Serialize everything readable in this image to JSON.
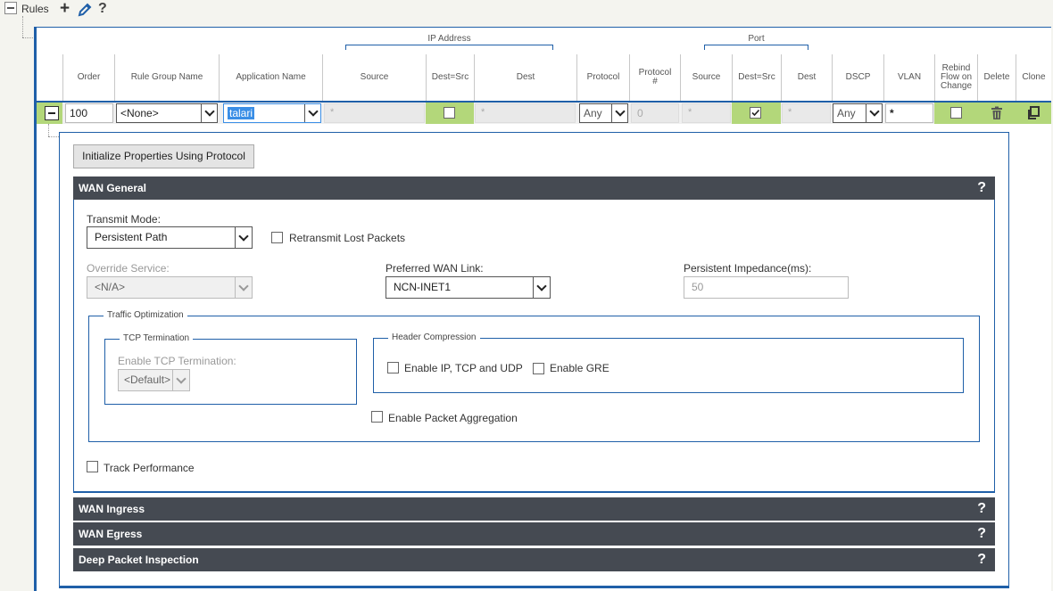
{
  "tree": {
    "title": "Rules"
  },
  "toolbar": {
    "add_symbol": "+",
    "help_symbol": "?"
  },
  "grid": {
    "groups": {
      "ip_address": "IP Address",
      "port": "Port"
    },
    "headers": {
      "order": "Order",
      "rule_group_name": "Rule Group Name",
      "application_name": "Application Name",
      "ip_source": "Source",
      "ip_dest_src": "Dest=Src",
      "ip_dest": "Dest",
      "protocol": "Protocol",
      "protocol_num": "Protocol #",
      "port_source": "Source",
      "port_dest_src": "Dest=Src",
      "port_dest": "Dest",
      "dscp": "DSCP",
      "vlan": "VLAN",
      "rebind": "Rebind Flow on Change",
      "delete": "Delete",
      "clone": "Clone"
    },
    "row": {
      "order": "100",
      "rule_group_name": "<None>",
      "application_name": "talari",
      "ip_source": "*",
      "ip_dest_src_checked": false,
      "ip_dest": "*",
      "protocol": "Any",
      "protocol_num": "0",
      "port_source": "*",
      "port_dest_src_checked": true,
      "port_dest": "*",
      "dscp": "Any",
      "vlan": "*",
      "rebind_checked": false
    }
  },
  "detail": {
    "init_button": "Initialize Properties Using Protocol",
    "sections": {
      "wan_general": "WAN General",
      "wan_ingress": "WAN Ingress",
      "wan_egress": "WAN Egress",
      "dpi": "Deep Packet Inspection"
    },
    "help_symbol": "?",
    "wan_general": {
      "transmit_mode_label": "Transmit Mode:",
      "transmit_mode": "Persistent Path",
      "retransmit_label": "Retransmit Lost Packets",
      "override_service_label": "Override Service:",
      "override_service": "<N/A>",
      "preferred_wan_link_label": "Preferred WAN Link:",
      "preferred_wan_link": "NCN-INET1",
      "persistent_impedance_label": "Persistent Impedance(ms):",
      "persistent_impedance": "50",
      "traffic_optimization_legend": "Traffic Optimization",
      "tcp_termination_legend": "TCP Termination",
      "enable_tcp_termination_label": "Enable TCP Termination:",
      "enable_tcp_termination": "<Default>",
      "header_compression_legend": "Header Compression",
      "enable_ip_tcp_udp_label": "Enable IP, TCP and UDP",
      "enable_gre_label": "Enable GRE",
      "enable_packet_aggregation_label": "Enable Packet Aggregation",
      "track_performance_label": "Track Performance"
    }
  },
  "colors": {
    "accent": "#1f5fa8",
    "bar": "#454a52",
    "row_green": "#b3d77a",
    "selection": "#3a8ee6"
  }
}
